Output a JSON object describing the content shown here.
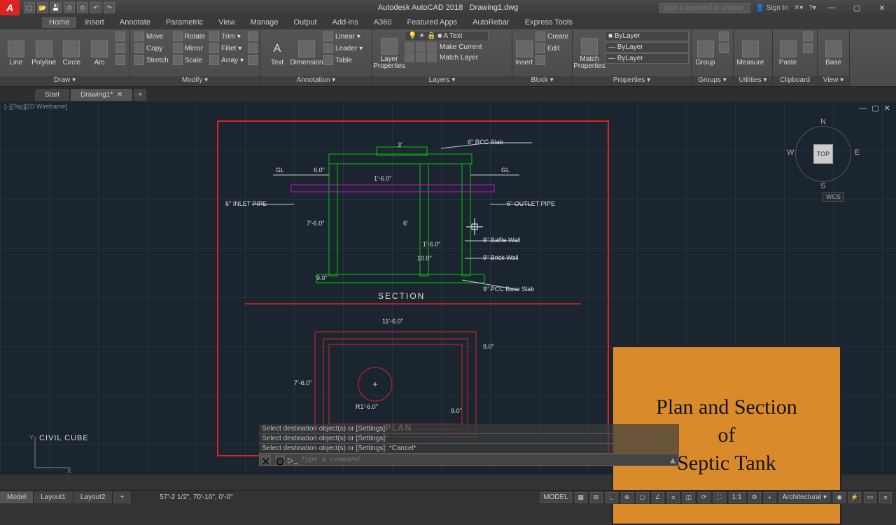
{
  "title": {
    "app": "Autodesk AutoCAD 2018",
    "file": "Drawing1.dwg"
  },
  "search": {
    "placeholder": "Type a keyword or phrase"
  },
  "signin": "Sign In",
  "menus": [
    "Home",
    "Insert",
    "Annotate",
    "Parametric",
    "View",
    "Manage",
    "Output",
    "Add-ins",
    "A360",
    "Featured Apps",
    "AutoRebar",
    "Express Tools"
  ],
  "activeMenu": "Home",
  "ribbon": {
    "draw": {
      "title": "Draw ▾",
      "big": [
        "Line",
        "Polyline",
        "Circle",
        "Arc"
      ]
    },
    "modify": {
      "title": "Modify ▾",
      "rows": [
        [
          "Move",
          "Rotate",
          "Trim"
        ],
        [
          "Copy",
          "Mirror",
          "Fillet"
        ],
        [
          "Stretch",
          "Scale",
          "Array"
        ]
      ]
    },
    "annotation": {
      "title": "Annotation ▾",
      "big": "Text",
      "dim": "Dimension",
      "rows": [
        [
          "Linear"
        ],
        [
          "Leader"
        ],
        [
          "Table"
        ]
      ],
      "combo": "A Text"
    },
    "layers": {
      "title": "Layers ▾",
      "big": "Layer\nProperties",
      "rows": [
        [
          "",
          "",
          "",
          ""
        ],
        [
          "",
          "",
          "",
          "Make Current"
        ],
        [
          "",
          "",
          "",
          "Match Layer"
        ]
      ]
    },
    "block": {
      "title": "Block ▾",
      "big": "Insert",
      "rows": [
        "Create",
        "Edit",
        ""
      ]
    },
    "properties": {
      "title": "Properties ▾",
      "big": "Match\nProperties",
      "combos": [
        "ByLayer",
        "ByLayer",
        "ByLayer"
      ]
    },
    "groups": {
      "title": "Groups ▾",
      "big": "Group"
    },
    "utilities": {
      "title": "Utilities ▾",
      "big": "Measure"
    },
    "clipboard": {
      "title": "Clipboard",
      "big": "Paste"
    },
    "view": {
      "title": "View ▾",
      "big": "Base"
    }
  },
  "fileTabs": [
    "Start",
    "Drawing1*"
  ],
  "viewLabel": "[–][Top][2D Wireframe]",
  "viewcube": {
    "face": "TOP",
    "n": "N",
    "s": "S",
    "e": "E",
    "w": "W",
    "wcs": "WCS"
  },
  "drawing": {
    "sectionTitle": "SECTION",
    "planTitle": "PLAN",
    "gl": "GL",
    "annotations": {
      "rccSlab": "6\" RCC Slab",
      "inlet": "6\" INLET PIPE",
      "outlet": "6\" OUTLET PIPE",
      "baffle": "9\" Baffle Wall",
      "brick": "9\" Brick Wall",
      "pccBase": "9\" PCC Base Slab"
    },
    "dims": {
      "d3": "3'",
      "d6in": "6.0\"",
      "d1_6": "1'-6.0\"",
      "d7_6": "7'-6.0\"",
      "d6ft": "6'",
      "d10": "10.0\"",
      "d9": "9.0\"",
      "d11_6": "11'-6.0\"",
      "r1_6": "R1'-6.0\""
    }
  },
  "overlay": {
    "l1": "Plan and Section",
    "l2": "of",
    "l3": "Septic Tank"
  },
  "brand": "CIVIL CUBE",
  "cmd": {
    "hist": [
      "Select destination object(s) or [Settings]:",
      "Select destination object(s) or [Settings]:",
      "Select destination object(s) or [Settings]: *Cancel*"
    ],
    "placeholder": "Type a command"
  },
  "layoutTabs": [
    "Model",
    "Layout1",
    "Layout2"
  ],
  "status": {
    "coord": "57'-2 1/2\", 70'-10\", 0'-0\"",
    "model": "MODEL",
    "scale": "1:1",
    "units": "Architectural"
  }
}
